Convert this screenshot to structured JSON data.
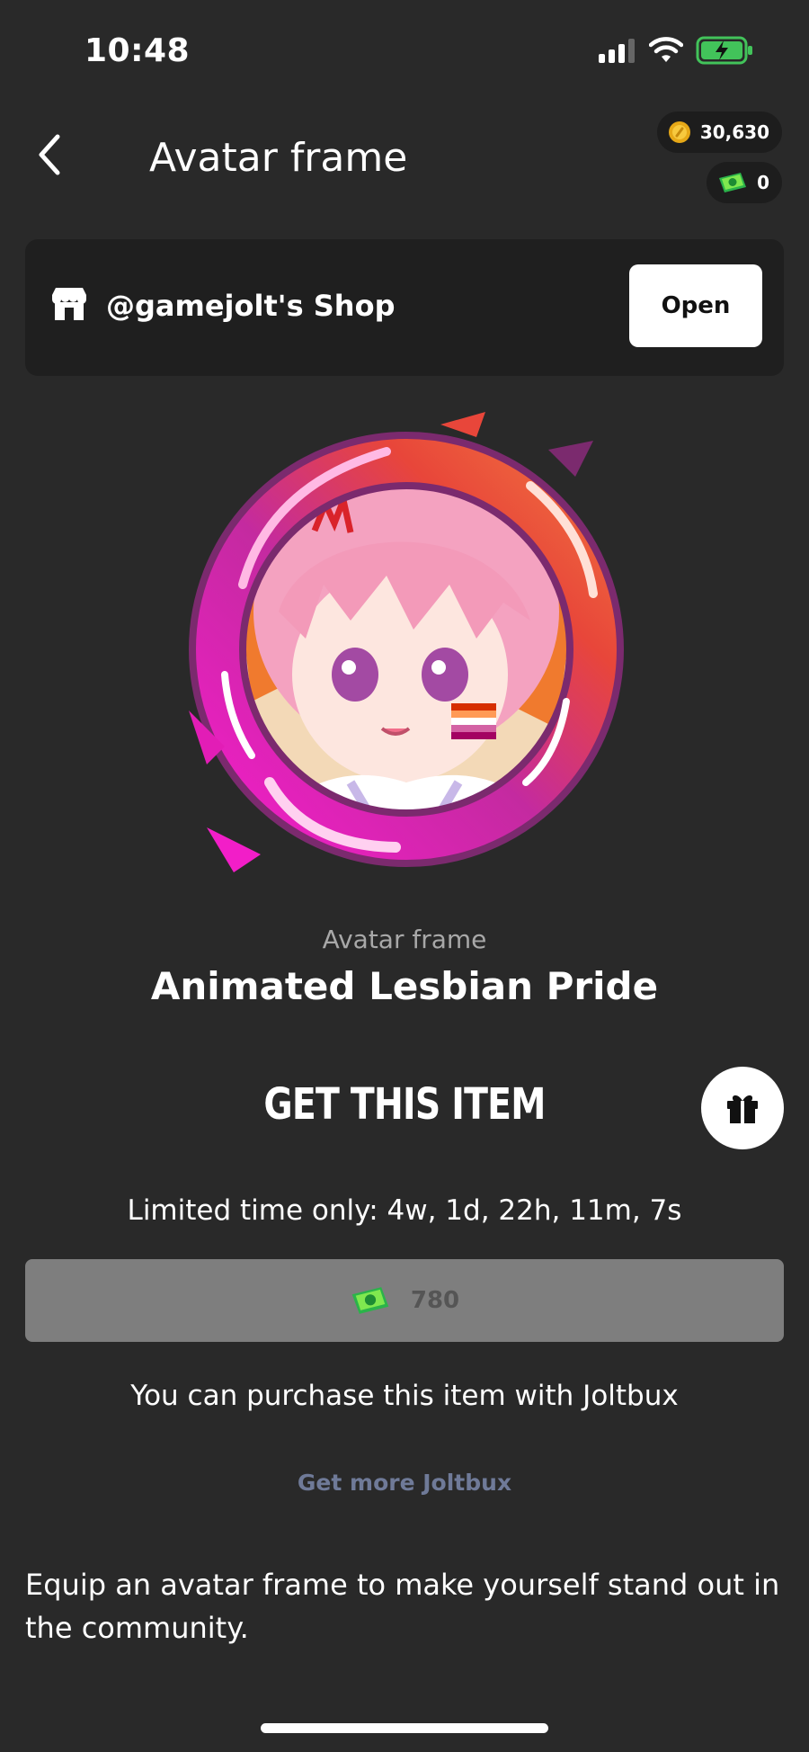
{
  "status_bar": {
    "time": "10:48"
  },
  "header": {
    "title": "Avatar frame"
  },
  "wallet": {
    "coins": "30,630",
    "joltbux": "0"
  },
  "shop": {
    "name": "@gamejolt's Shop",
    "open_label": "Open"
  },
  "item": {
    "type": "Avatar frame",
    "name": "Animated Lesbian Pride"
  },
  "purchase": {
    "title": "GET THIS ITEM",
    "limited_text": "Limited time only: 4w, 1d, 22h, 11m, 7s",
    "price": "780",
    "note": "You can purchase this item with Joltbux",
    "get_more_label": "Get more Joltbux"
  },
  "description": "Equip an avatar frame to make yourself stand out in the community.",
  "colors": {
    "background": "#292929",
    "card": "#1f1f1f",
    "price_button": "#7e7e7e",
    "link": "#6f7a98",
    "frame_pink": "#e91fc4",
    "frame_red": "#e8463a"
  },
  "icons": [
    "battery-icon",
    "wifi-icon",
    "signal-icon",
    "back-chevron-icon",
    "coin-icon",
    "joltbux-icon",
    "shop-icon",
    "gift-icon"
  ]
}
